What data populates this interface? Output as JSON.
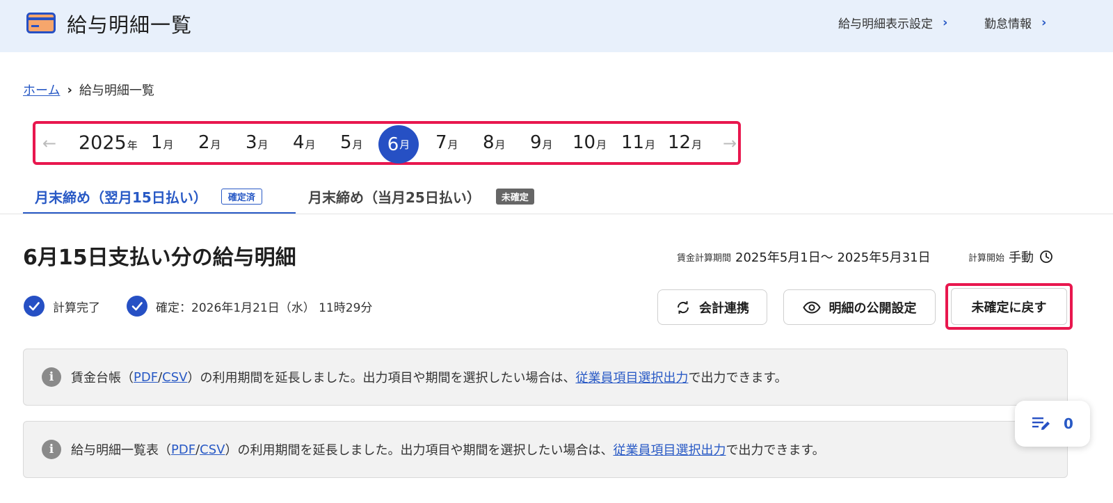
{
  "header": {
    "title": "給与明細一覧",
    "links": [
      {
        "label": "給与明細表示設定"
      },
      {
        "label": "勤怠情報"
      }
    ]
  },
  "breadcrumb": {
    "home": "ホーム",
    "current": "給与明細一覧"
  },
  "month_nav": {
    "year": "2025",
    "year_unit": "年",
    "month_unit": "月",
    "months": [
      "1",
      "2",
      "3",
      "4",
      "5",
      "6",
      "7",
      "8",
      "9",
      "10",
      "11",
      "12"
    ],
    "selected_month": "6"
  },
  "tabs": [
    {
      "label": "月末締め（翌月15日払い）",
      "badge": "確定済",
      "active": true
    },
    {
      "label": "月末締め（当月25日払い）",
      "badge": "未確定",
      "active": false
    }
  ],
  "payslip": {
    "title": "6月15日支払い分の給与明細",
    "period_label": "賃金計算期間",
    "period_value": "2025年5月1日〜 2025年5月31日",
    "calc_start_label": "計算開始",
    "calc_start_value": "手動"
  },
  "status": {
    "calc_done": "計算完了",
    "confirmed": "確定：2026年1月21日（水） 11時29分"
  },
  "actions": {
    "accounting": "会計連携",
    "publish": "明細の公開設定",
    "revert": "未確定に戻す"
  },
  "notices": [
    {
      "prefix": "賃金台帳（",
      "pdf": "PDF",
      "slash": "/",
      "csv": "CSV",
      "middle": "）の利用期間を延長しました。出力項目や期間を選択したい場合は、",
      "link": "従業員項目選択出力",
      "suffix": "で出力できます。"
    },
    {
      "prefix": "給与明細一覧表（",
      "pdf": "PDF",
      "slash": "/",
      "csv": "CSV",
      "middle": "）の利用期間を延長しました。出力項目や期間を選択したい場合は、",
      "link": "従業員項目選択出力",
      "suffix": "で出力できます。"
    }
  ],
  "floating": {
    "count": "0"
  },
  "colors": {
    "accent": "#2650c4",
    "highlight": "#e8174e",
    "header_bg": "#e8f0fb"
  }
}
